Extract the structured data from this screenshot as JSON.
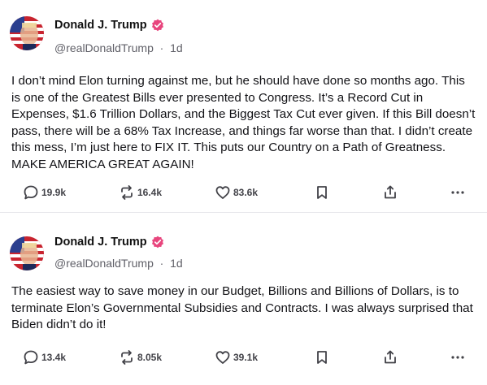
{
  "posts": [
    {
      "author": {
        "name": "Donald J. Trump",
        "handle": "@realDonaldTrump",
        "time": "1d",
        "separator": "·"
      },
      "text": "I don’t mind Elon turning against me, but he should have done so months ago. This is one of the Greatest Bills ever presented to Congress. It’s a Record Cut in Expenses, $1.6 Trillion Dollars, and the Biggest Tax Cut ever given. If this Bill doesn’t pass, there will be a 68% Tax Increase, and things far worse than that. I didn’t create this mess, I’m just here to FIX IT. This puts our Country on a Path of Greatness. MAKE AMERICA GREAT AGAIN!",
      "stats": {
        "replies": "19.9k",
        "reposts": "16.4k",
        "likes": "83.6k"
      }
    },
    {
      "author": {
        "name": "Donald J. Trump",
        "handle": "@realDonaldTrump",
        "time": "1d",
        "separator": "·"
      },
      "text": "The easiest way to save money in our Budget, Billions and Billions of Dollars, is to terminate Elon’s Governmental Subsidies and Contracts. I was always surprised that Biden didn’t do it!",
      "stats": {
        "replies": "13.4k",
        "reposts": "8.05k",
        "likes": "39.1k"
      }
    }
  ],
  "icons": {
    "reply": "speech-bubble-icon",
    "repost": "repost-arrows-icon",
    "like": "heart-icon",
    "save": "bookmark-icon",
    "share": "share-upload-icon",
    "more": "ellipsis-icon",
    "verified": "verified-badge-icon"
  },
  "colors": {
    "verified_badge": "#e8457d",
    "text": "#121216",
    "muted": "#606068",
    "divider": "#e6e6ea"
  }
}
